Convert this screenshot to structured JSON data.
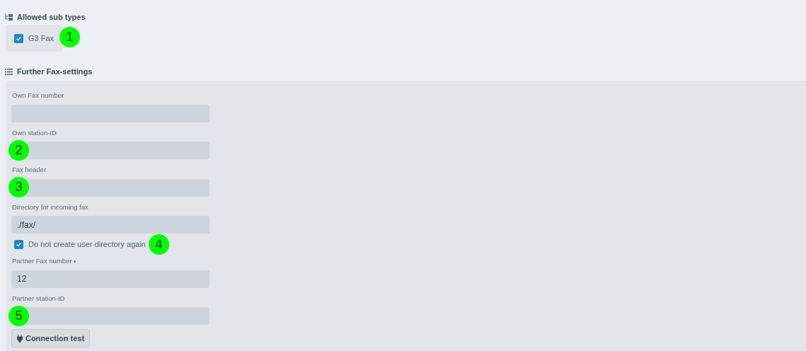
{
  "subtypes": {
    "title": "Allowed sub types",
    "items": [
      {
        "label": "G3 Fax",
        "checked": true,
        "callout": "1"
      }
    ]
  },
  "settings": {
    "title": "Further Fax-settings",
    "fields": [
      {
        "kind": "text",
        "label": "Own Fax number"
      },
      {
        "kind": "text",
        "label": "Own station-ID",
        "callout": "2"
      },
      {
        "kind": "text",
        "label": "Fax header",
        "callout": "3"
      },
      {
        "kind": "text",
        "label": "Directory for incoming fax",
        "value": "./fax/"
      },
      {
        "kind": "checkbox",
        "label": "Do not create user directory again",
        "checked": true,
        "callout": "4"
      },
      {
        "kind": "text",
        "label": "Partner Fax number",
        "required": true,
        "value": "12"
      },
      {
        "kind": "text",
        "label": "Partner station-ID",
        "callout": "5"
      }
    ],
    "button": "Connection test"
  }
}
